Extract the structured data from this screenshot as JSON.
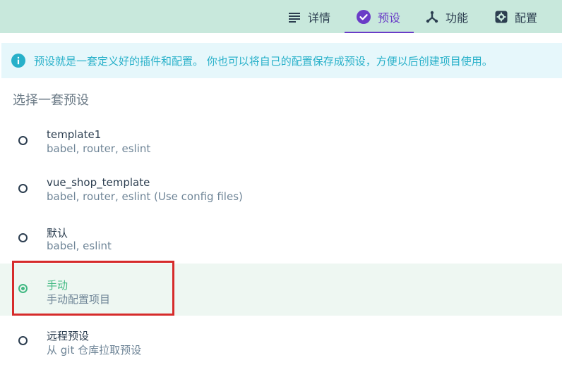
{
  "tabs": [
    {
      "label": "详情",
      "icon": "list-icon",
      "active": false
    },
    {
      "label": "预设",
      "icon": "check-circle-icon",
      "active": true
    },
    {
      "label": "功能",
      "icon": "fork-icon",
      "active": false
    },
    {
      "label": "配置",
      "icon": "gear-icon",
      "active": false
    }
  ],
  "info": {
    "icon": "info-icon",
    "text": "预设就是一套定义好的插件和配置。 你也可以将自己的配置保存成预设，方便以后创建项目使用。"
  },
  "section_title": "选择一套预设",
  "presets": [
    {
      "name": "template1",
      "description": "babel, router, eslint",
      "selected": false
    },
    {
      "name": "vue_shop_template",
      "description": "babel, router, eslint (Use config files)",
      "selected": false
    },
    {
      "name": "默认",
      "description": "babel, eslint",
      "selected": false
    },
    {
      "name": "手动",
      "description": "手动配置项目",
      "selected": true
    },
    {
      "name": "远程预设",
      "description": "从 git 仓库拉取预设",
      "selected": false
    }
  ],
  "colors": {
    "topbar_bg": "#c8e8dc",
    "accent_purple": "#6a3cc7",
    "info_bg": "#e6f7fb",
    "info_text": "#27b0c9",
    "selected_green": "#42b983",
    "highlight_red": "#d62b2b"
  }
}
